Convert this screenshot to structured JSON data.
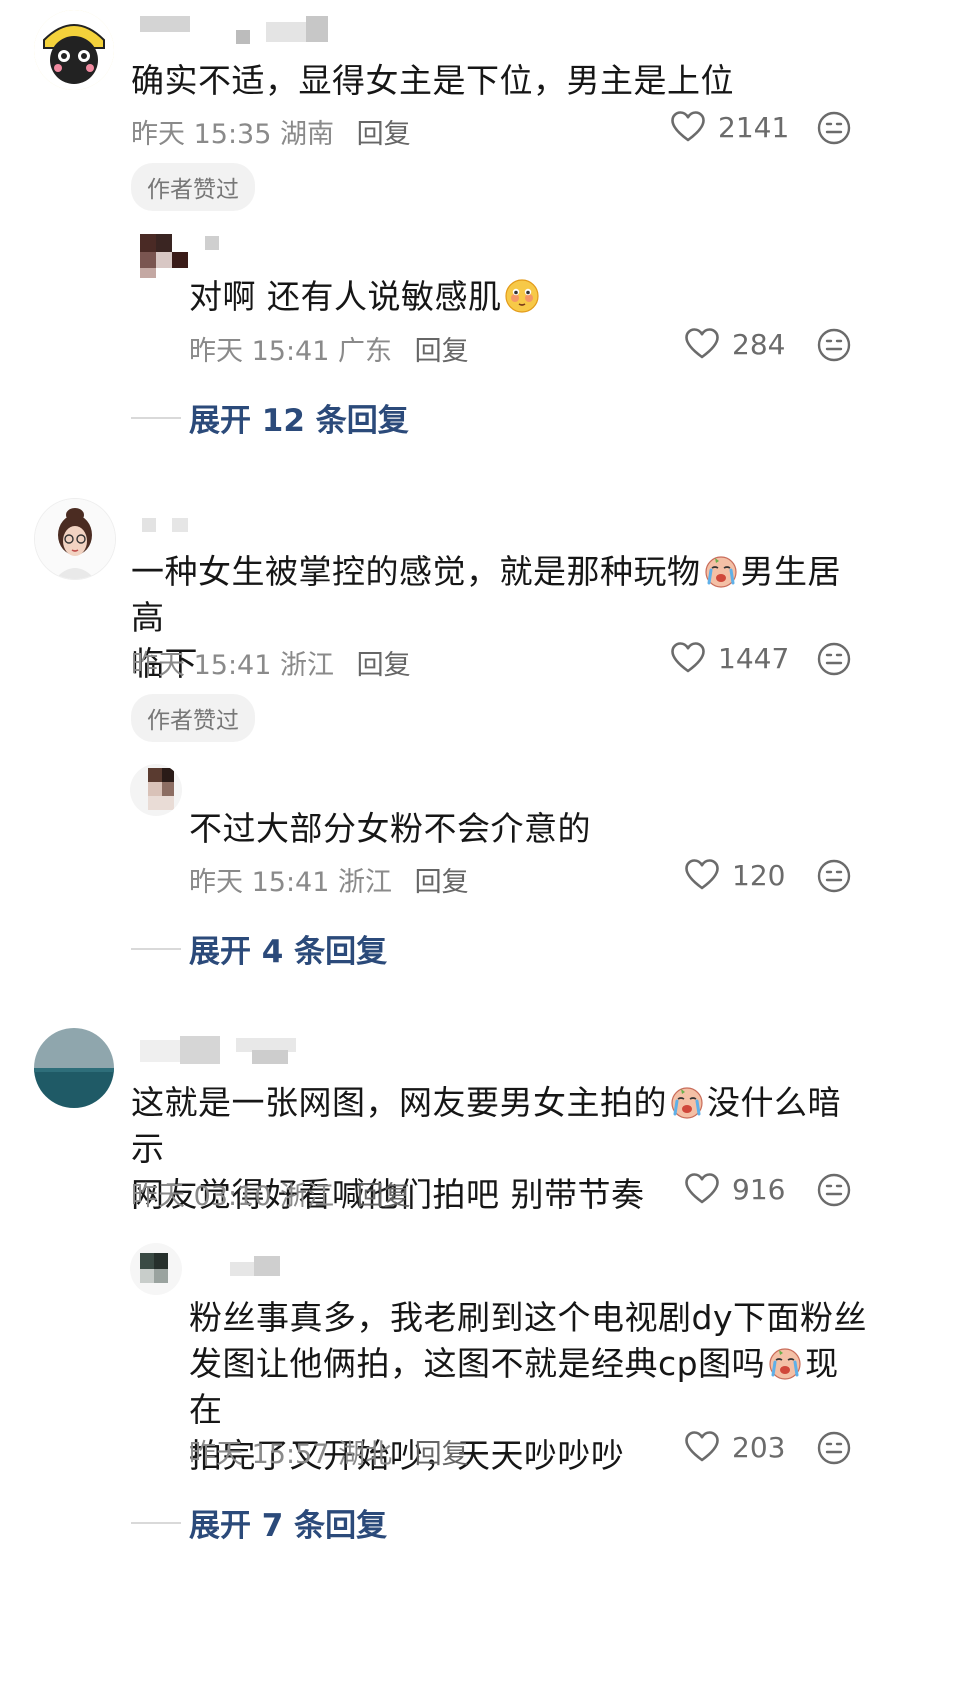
{
  "threads": [
    {
      "comment": {
        "text": "确实不适，显得女主是下位，男主是上位",
        "time": "昨天 15:35",
        "location": "湖南",
        "reply_label": "回复",
        "likes": "2141",
        "badge": "作者赞过"
      },
      "sub": {
        "text": "对啊 还有人说敏感肌",
        "time": "昨天 15:41",
        "location": "广东",
        "reply_label": "回复",
        "likes": "284"
      },
      "expand_label": "展开 12 条回复"
    },
    {
      "comment": {
        "text_line1": "一种女生被掌控的感觉，就是那种玩物",
        "text_line1_after": "男生居高",
        "text_line2": "临下",
        "time": "昨天 15:41",
        "location": "浙江",
        "reply_label": "回复",
        "likes": "1447",
        "badge": "作者赞过"
      },
      "sub": {
        "text": "不过大部分女粉不会介意的",
        "time": "昨天 15:41",
        "location": "浙江",
        "reply_label": "回复",
        "likes": "120"
      },
      "expand_label": "展开 4 条回复"
    },
    {
      "comment": {
        "text_line1": "这就是一张网图，网友要男女主拍的",
        "text_line1_after": "没什么暗示",
        "text_line2": "网友觉得好看喊他们拍吧 别带节奏",
        "time": "昨天 03:10",
        "location": "浙江",
        "reply_label": "回复",
        "likes": "916"
      },
      "sub": {
        "text_line1": "粉丝事真多，我老刷到这个电视剧dy下面粉丝",
        "text_line2": "发图让他俩拍，这图不就是经典cp图吗",
        "text_line2_after": "现在",
        "text_line3": "拍完了又开始吵，天天吵吵吵",
        "time": "昨天 15:57",
        "location": "湖北",
        "reply_label": "回复",
        "likes": "203"
      },
      "expand_label": "展开 7 条回复"
    }
  ],
  "icons": {
    "like": "heart-outline-icon",
    "emoji": "emoji-face-icon"
  },
  "colors": {
    "expand_text": "#2b4a7a",
    "meta_text": "#8a8a8a",
    "badge_bg": "#f2f2f2"
  }
}
